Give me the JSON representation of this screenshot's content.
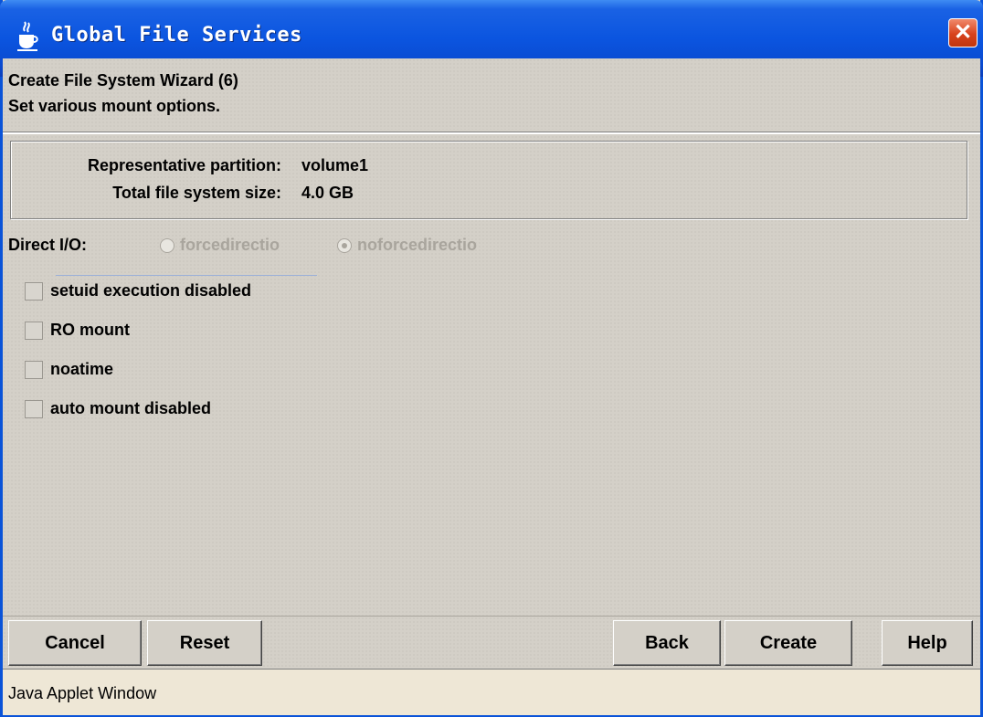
{
  "window": {
    "title": "Global File Services",
    "close_glyph": "✕"
  },
  "header": {
    "line1": "Create File System Wizard (6)",
    "line2": "Set various mount options."
  },
  "info": {
    "partition_label": "Representative partition:",
    "partition_value": "volume1",
    "size_label": "Total file system size:",
    "size_value": "4.0 GB"
  },
  "direct_io": {
    "label": "Direct I/O:",
    "options": [
      {
        "label": "forcedirectio",
        "selected": false,
        "enabled": false
      },
      {
        "label": "noforcedirectio",
        "selected": true,
        "enabled": false
      }
    ]
  },
  "options": [
    {
      "label": "setuid execution disabled",
      "checked": false
    },
    {
      "label": "RO mount",
      "checked": false
    },
    {
      "label": "noatime",
      "checked": false
    },
    {
      "label": "auto mount disabled",
      "checked": false
    }
  ],
  "buttons": {
    "cancel": "Cancel",
    "reset": "Reset",
    "back": "Back",
    "create": "Create",
    "help": "Help"
  },
  "status": {
    "text": "Java Applet Window"
  },
  "icons": {
    "title_icon": "java-coffee-cup-icon",
    "close_icon": "close-icon"
  },
  "colors": {
    "titlebar": "#0b55e0",
    "close": "#d8421c",
    "panel": "#d4d0c8",
    "status_bg": "#eee7d6"
  }
}
